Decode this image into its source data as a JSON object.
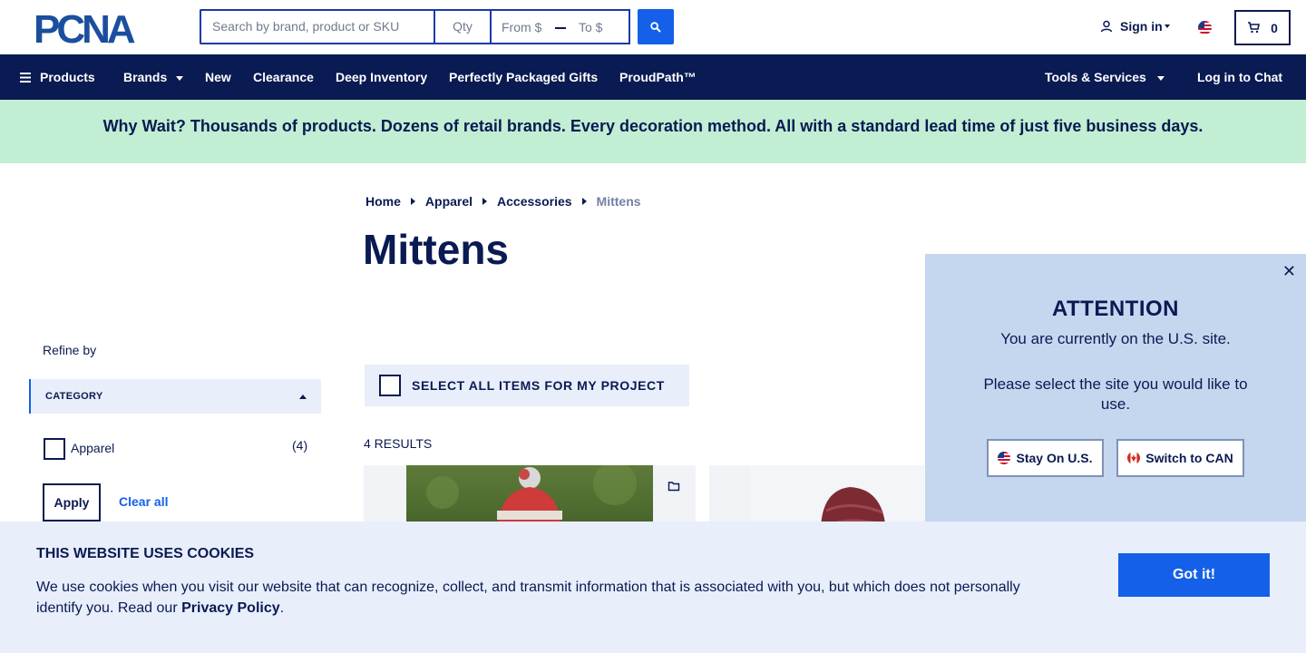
{
  "header": {
    "logo_text": "PCNA",
    "search_placeholder": "Search by brand, product or SKU",
    "qty_placeholder": "Qty",
    "price_from_placeholder": "From $",
    "price_to_placeholder": "To $",
    "signin_label": "Sign in",
    "cart_count": "0"
  },
  "nav": {
    "products": "Products",
    "brands": "Brands",
    "new": "New",
    "clearance": "Clearance",
    "deep_inventory": "Deep Inventory",
    "gifts": "Perfectly Packaged Gifts",
    "proudpath": "ProudPath™",
    "tools": "Tools & Services",
    "chat": "Log in to Chat"
  },
  "promo": {
    "text": "Why Wait? Thousands of products. Dozens of retail brands. Every decoration method. All with a standard lead time of just five business days."
  },
  "breadcrumb": {
    "items": [
      "Home",
      "Apparel",
      "Accessories"
    ],
    "current": "Mittens"
  },
  "page_title": "Mittens",
  "sidebar": {
    "refine_label": "Refine by",
    "category_label": "CATEGORY",
    "filters": [
      {
        "label": "Apparel",
        "count": "(4)"
      }
    ],
    "apply_label": "Apply",
    "clear_label": "Clear all"
  },
  "main": {
    "select_all_label": "SELECT ALL ITEMS FOR MY PROJECT",
    "results_label": "4 RESULTS"
  },
  "attention": {
    "title": "ATTENTION",
    "line1": "You are currently on the U.S. site.",
    "line2": "Please select the site you would like to use.",
    "stay_label": "Stay On U.S.",
    "switch_label": "Switch to CAN"
  },
  "cookie": {
    "title": "THIS WEBSITE USES COOKIES",
    "text": "We use cookies when you visit our website that can recognize, collect, and transmit information that is associated with you, but which does not personally identify you. Read our",
    "link": "Privacy Policy",
    "trailing": ".",
    "button": "Got it!"
  },
  "colors": {
    "navy": "#0a1a52",
    "accent_blue": "#1560e8",
    "promo_green": "#c2eed3",
    "panel_blue": "#c5d6ef"
  },
  "icons": [
    "search-icon",
    "user-icon",
    "us-flag-icon",
    "cart-icon",
    "menu-icon",
    "caret-down-icon",
    "folder-icon",
    "close-icon",
    "canada-flag-icon"
  ]
}
